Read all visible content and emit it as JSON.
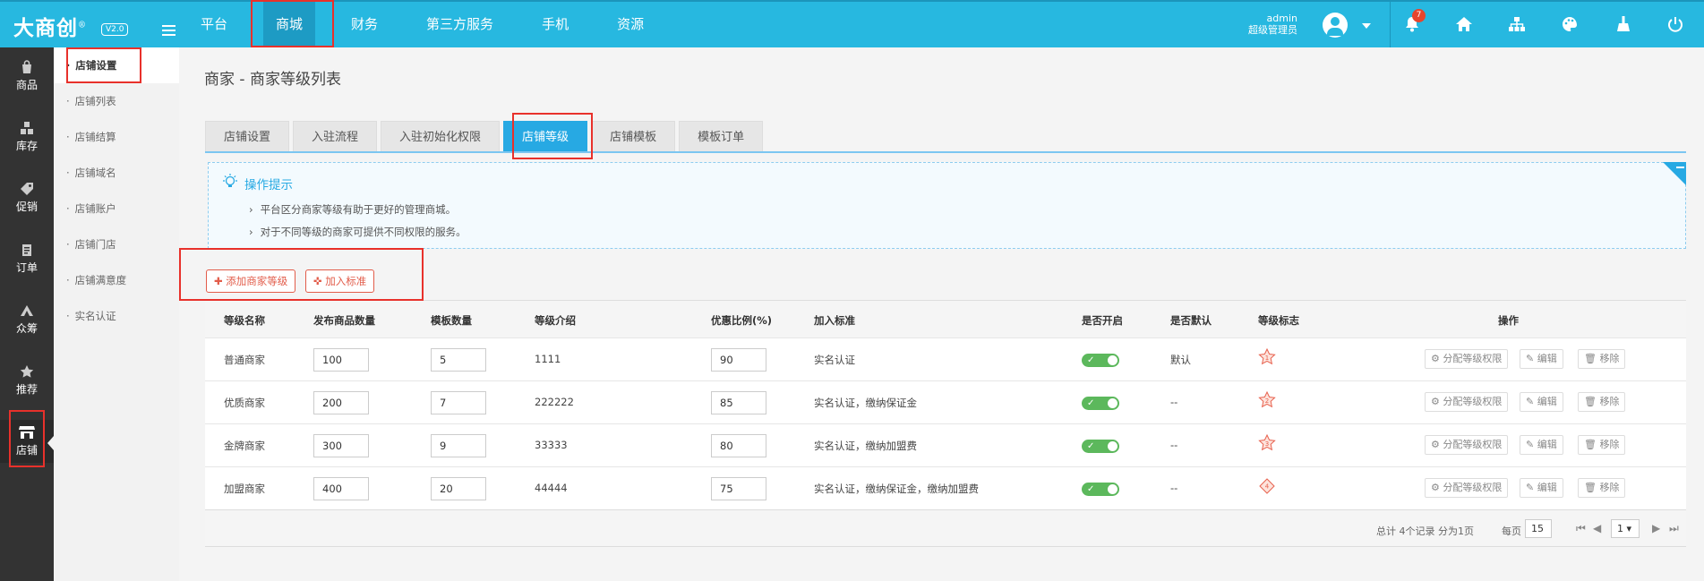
{
  "topbar": {
    "logo": "大商创",
    "logo_mark": "®",
    "version": "V2.0",
    "nav": [
      "平台",
      "商城",
      "财务",
      "第三方服务",
      "手机",
      "资源"
    ],
    "user_name": "admin",
    "user_role": "超级管理员",
    "notification_count": "7"
  },
  "sidebar": [
    "商品",
    "库存",
    "促销",
    "订单",
    "众筹",
    "推荐",
    "店铺"
  ],
  "submenu": [
    "店铺设置",
    "店铺列表",
    "店铺结算",
    "店铺域名",
    "店铺账户",
    "店铺门店",
    "店铺满意度",
    "实名认证"
  ],
  "page_title": "商家 - 商家等级列表",
  "tabs": [
    "店铺设置",
    "入驻流程",
    "入驻初始化权限",
    "店铺等级",
    "店铺模板",
    "模板订单"
  ],
  "tips": {
    "title": "操作提示",
    "items": [
      "平台区分商家等级有助于更好的管理商城。",
      "对于不同等级的商家可提供不同权限的服务。"
    ]
  },
  "actions": {
    "add": "添加商家等级",
    "join": "加入标准"
  },
  "table": {
    "headers": [
      "等级名称",
      "发布商品数量",
      "模板数量",
      "等级介绍",
      "优惠比例(%)",
      "加入标准",
      "是否开启",
      "是否默认",
      "等级标志",
      "操作"
    ],
    "rows": [
      {
        "name": "普通商家",
        "goods": "100",
        "templates": "5",
        "intro": "1111",
        "discount": "90",
        "standard": "实名认证",
        "default": "默认",
        "level": "1"
      },
      {
        "name": "优质商家",
        "goods": "200",
        "templates": "7",
        "intro": "222222",
        "discount": "85",
        "standard": "实名认证，缴纳保证金",
        "default": "--",
        "level": "2"
      },
      {
        "name": "金牌商家",
        "goods": "300",
        "templates": "9",
        "intro": "33333",
        "discount": "80",
        "standard": "实名认证，缴纳加盟费",
        "default": "--",
        "level": "3"
      },
      {
        "name": "加盟商家",
        "goods": "400",
        "templates": "20",
        "intro": "44444",
        "discount": "75",
        "standard": "实名认证，缴纳保证金，缴纳加盟费",
        "default": "--",
        "level": "4"
      }
    ],
    "ops": {
      "assign": "分配等级权限",
      "edit": "编辑",
      "remove": "移除"
    }
  },
  "footer": {
    "summary": "总计 4个记录 分为1页",
    "per_page_label": "每页",
    "per_page": "15",
    "page": "1"
  },
  "colors": {
    "topbar": "#27b8e0",
    "accent": "#27a9e3",
    "danger": "#e25c4a",
    "toggle_on": "#5cb85c"
  }
}
